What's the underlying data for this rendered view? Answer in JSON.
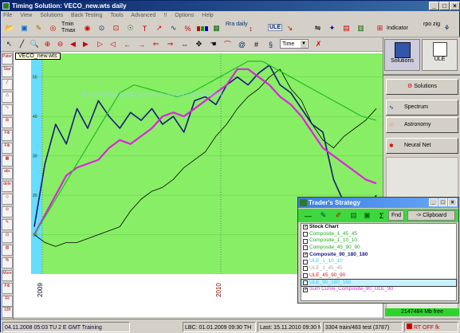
{
  "window": {
    "title": "Timing Solution:  VECO_new.wts  daily"
  },
  "menu": [
    "File",
    "View",
    "Solutions",
    "Back Testing",
    "Tools",
    "Advanced",
    "!!",
    "Options",
    "Help"
  ],
  "toolbar": {
    "tmin": "Tmin",
    "tmax": "Tmax",
    "rdaily": "Rra daily",
    "ule": "ULE",
    "time": "Time",
    "indicator": "Indicator",
    "rpo_zig": "rpo zig"
  },
  "chart": {
    "tab": "VECO_new.wts",
    "watermark": "Demo Version (prediction line is not available till 2010)",
    "y_labels": [
      "50",
      "40",
      "30",
      "20",
      "10"
    ],
    "x_labels": [
      "2009",
      "2010"
    ],
    "colors": {
      "bg": "#88ee66",
      "price": "#000000",
      "navy": "#1a1a7a",
      "magenta": "#dd22dd",
      "green": "#22bb22",
      "cyan": "#66ddff"
    }
  },
  "chart_data": {
    "type": "line",
    "x_ticks": [
      "2009",
      "2010"
    ],
    "y_ticks": [
      10,
      20,
      30,
      40,
      50
    ],
    "series": [
      {
        "name": "Stock Chart",
        "color": "#000000",
        "values": [
          10,
          8,
          7,
          8,
          8,
          9,
          10,
          11,
          12,
          16,
          19,
          21,
          22,
          24,
          27,
          29,
          31,
          35,
          38,
          42,
          45,
          47,
          50,
          52,
          47,
          44,
          38,
          34,
          32,
          35,
          37,
          39,
          42
        ]
      },
      {
        "name": "Composite_90_180_180",
        "color": "#1a1a7a",
        "values": [
          12,
          28,
          38,
          33,
          42,
          37,
          44,
          40,
          37,
          41,
          39,
          42,
          38,
          40,
          36,
          44,
          45,
          43,
          48,
          50,
          48,
          51,
          53,
          48,
          46,
          42,
          38,
          36,
          24,
          18,
          14,
          16,
          20
        ]
      },
      {
        "name": "Sum Curve_Composite_90_ULE_90",
        "color": "#dd22dd",
        "values": [
          10,
          15,
          20,
          25,
          27,
          28,
          29,
          32,
          34,
          33,
          35,
          37,
          40,
          41,
          40,
          42,
          44,
          46,
          48,
          52,
          52,
          50,
          48,
          45,
          43,
          40,
          36,
          32,
          30,
          28,
          26,
          24,
          23
        ]
      },
      {
        "name": "Composite_45_90_90",
        "color": "#22bb22",
        "values": [
          10,
          16,
          22,
          28,
          34,
          40,
          46,
          48,
          47,
          46,
          45,
          46,
          48,
          50,
          52,
          54,
          54,
          52,
          50,
          48,
          46,
          44,
          42,
          40,
          39
        ]
      }
    ]
  },
  "right_panel": {
    "solutions_btn": "Solutions",
    "ule_btn": "ULE",
    "buttons": [
      "Solutions",
      "Spectrum",
      "Astronomy",
      "Neural Net"
    ],
    "memory": "2147484 Mb free"
  },
  "dialog": {
    "title": "Trader's Strategy",
    "fnd": "Fnd",
    "clipboard": "-> Clipboard",
    "items": [
      {
        "label": "Stock Chart",
        "checked": true,
        "color": "#000000",
        "bold": true
      },
      {
        "label": "Composite_1_45_45",
        "checked": false,
        "color": "#22aa22",
        "bold": false
      },
      {
        "label": "Composite_1_10_10",
        "checked": false,
        "color": "#22aa22",
        "bold": false
      },
      {
        "label": "Composite_45_90_90",
        "checked": false,
        "color": "#22aa22",
        "bold": false
      },
      {
        "label": "Composite_90_180_180",
        "checked": true,
        "color": "#1a1a7a",
        "bold": true
      },
      {
        "label": "ULE_1_10_10",
        "checked": false,
        "color": "#33ccee",
        "bold": false
      },
      {
        "label": "ULE_1_45_45",
        "checked": false,
        "color": "#aaaaaa",
        "bold": false
      },
      {
        "label": "ULE_45_90_90",
        "checked": false,
        "color": "#cc2222",
        "bold": false
      },
      {
        "label": "ULE_90_180_180",
        "checked": false,
        "color": "#33ccee",
        "bold": false
      },
      {
        "label": "Sum Curve_Composite_90_ULE_90",
        "checked": true,
        "color": "#dd22dd",
        "bold": false
      }
    ]
  },
  "status": {
    "date": "04.11.2008 05:03 TU  2 E GMT  Training",
    "lbc": "LBC: 01.01.2009  09:30 TH",
    "last": "Last: 15.11.2010  09:30 MO",
    "train": "3304 train/483 test (3787)",
    "rt": "RT OFF fk"
  },
  "left_labels": [
    "Pater",
    "Star",
    "Fib",
    "Fib",
    "abc",
    "dele",
    "%",
    "More",
    "Fib",
    "Fil",
    "128"
  ]
}
